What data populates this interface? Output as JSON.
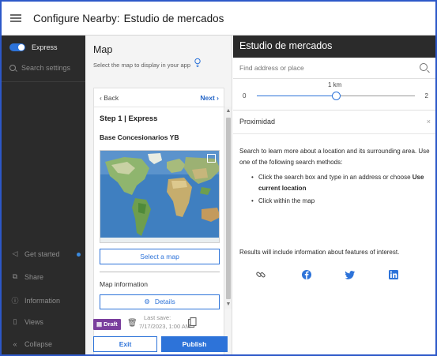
{
  "header": {
    "app_title": "Configure Nearby:",
    "app_name": "Estudio de mercados"
  },
  "sidebar": {
    "toggle_label": "Express",
    "search_placeholder": "Search settings",
    "items": [
      {
        "label": "Get started",
        "icon": "rocket-icon"
      },
      {
        "label": "Share",
        "icon": "share-icon"
      },
      {
        "label": "Information",
        "icon": "info-icon"
      },
      {
        "label": "Views",
        "icon": "device-icon"
      },
      {
        "label": "Collapse",
        "icon": "collapse-icon"
      }
    ]
  },
  "map_panel": {
    "title": "Map",
    "subtitle": "Select the map to display in your app",
    "back": "Back",
    "next": "Next",
    "step": "Step 1 | Express",
    "layer_title": "Base Concesionarios YB",
    "select_map": "Select a map",
    "map_information": "Map information",
    "details": "Details",
    "draft_badge": "Draft",
    "last_save_label": "Last save:",
    "last_save_value": "7/17/2023, 1:00 AM",
    "exit": "Exit",
    "publish": "Publish"
  },
  "preview": {
    "title": "Estudio de mercados",
    "search_placeholder": "Find address or place",
    "slider": {
      "min": "0",
      "max": "2",
      "value_label": "1 km",
      "value_fraction": 0.5
    },
    "proximity_title": "Proximidad",
    "close": "×",
    "intro": "Search to learn more about a location and its surrounding area. Use one of the following search methods:",
    "bullet1_prefix": "Click the search box and type in an address or choose ",
    "bullet1_bold": "Use current location",
    "bullet2": "Click within the map",
    "results_note": "Results will include information about features of interest.",
    "social_icons": [
      "link-icon",
      "facebook-icon",
      "twitter-icon",
      "linkedin-icon"
    ]
  },
  "colors": {
    "accent": "#2d73d9",
    "sidebar_bg": "#2b2b2b",
    "draft": "#7a3e9d",
    "frame_border": "#2d58c8"
  }
}
